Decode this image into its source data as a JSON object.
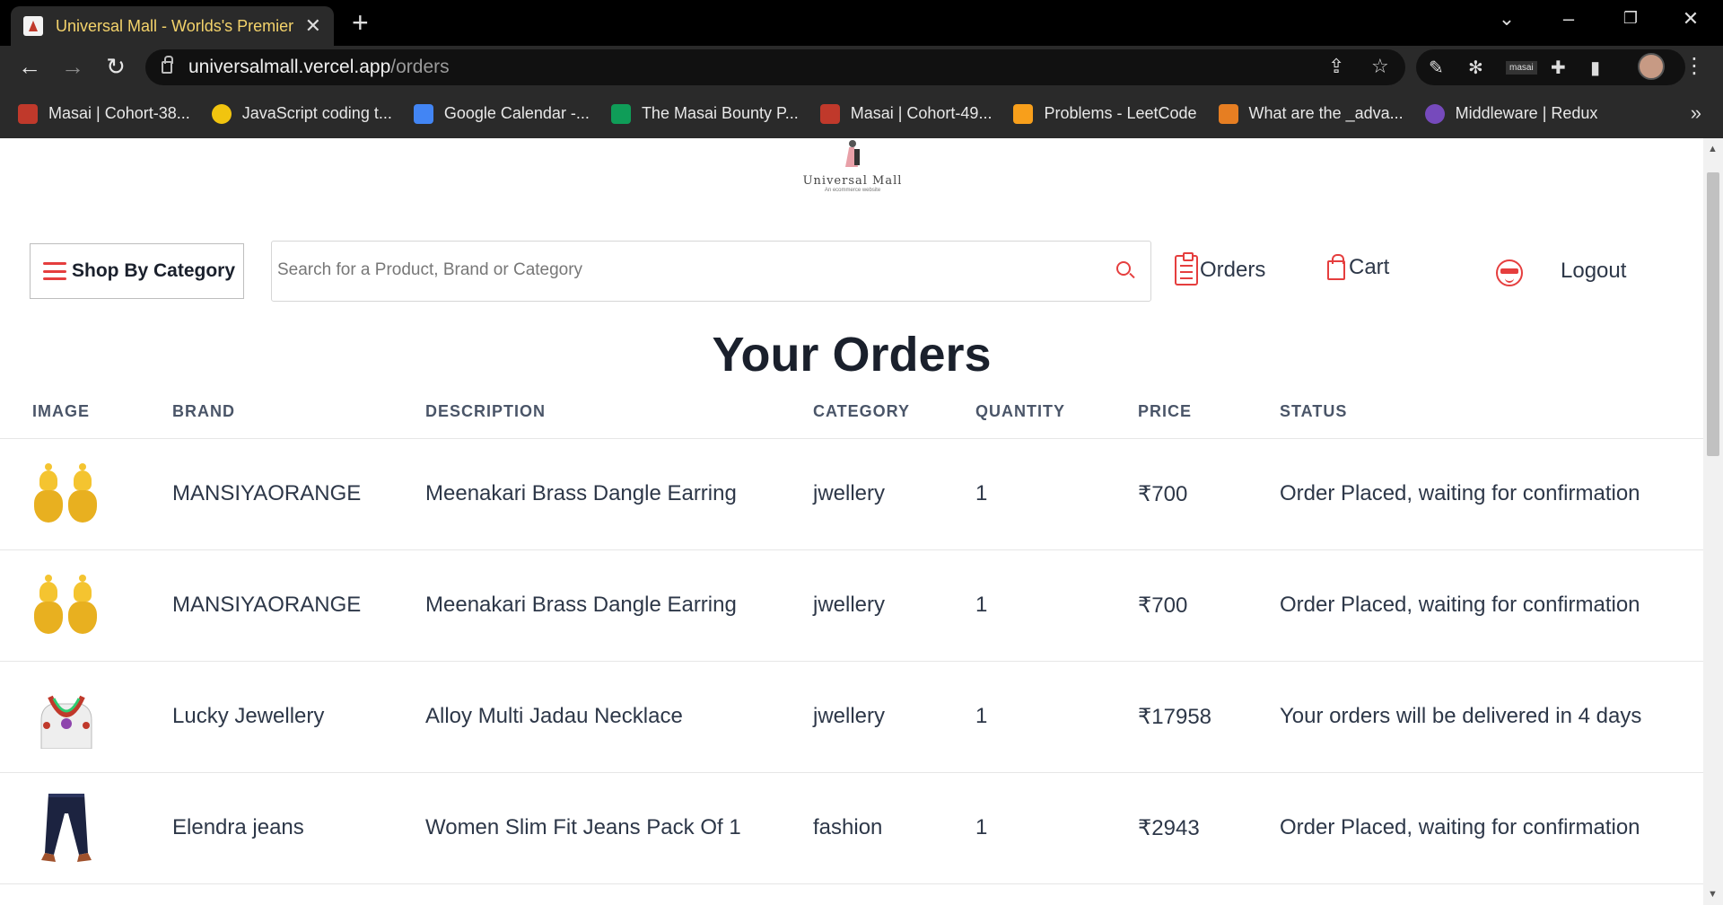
{
  "browser": {
    "tab_title": "Universal Mall - Worlds's Premier",
    "url_host": "universalmall.vercel.app",
    "url_path": "/orders",
    "bookmarks": [
      {
        "label": "Masai | Cohort-38...",
        "color": "#c0392b"
      },
      {
        "label": "JavaScript coding t...",
        "color": "#f1c40f"
      },
      {
        "label": "Google Calendar -...",
        "color": "#4285f4"
      },
      {
        "label": "The Masai Bounty P...",
        "color": "#0f9d58"
      },
      {
        "label": "Masai | Cohort-49...",
        "color": "#c0392b"
      },
      {
        "label": "Problems - LeetCode",
        "color": "#f89f1b"
      },
      {
        "label": "What are the _adva...",
        "color": "#e67e22"
      },
      {
        "label": "Middleware | Redux",
        "color": "#764abc"
      }
    ]
  },
  "header": {
    "logo_name": "Universal Mall",
    "logo_tagline": "An ecommerce website",
    "category_button": "Shop By Category",
    "search_placeholder": "Search for a Product, Brand or Category",
    "orders_label": "Orders",
    "cart_label": "Cart",
    "logout_label": "Logout",
    "accent_color": "#e53e3e"
  },
  "main": {
    "title": "Your Orders",
    "columns": [
      "IMAGE",
      "BRAND",
      "DESCRIPTION",
      "CATEGORY",
      "QUANTITY",
      "PRICE",
      "STATUS"
    ],
    "rows": [
      {
        "image": "earring-icon",
        "brand": "MANSIYAORANGE",
        "description": "Meenakari Brass Dangle Earring",
        "category": "jwellery",
        "quantity": "1",
        "price": "₹700",
        "status": "Order Placed, waiting for confirmation"
      },
      {
        "image": "earring-icon",
        "brand": "MANSIYAORANGE",
        "description": "Meenakari Brass Dangle Earring",
        "category": "jwellery",
        "quantity": "1",
        "price": "₹700",
        "status": "Order Placed, waiting for confirmation"
      },
      {
        "image": "necklace-icon",
        "brand": "Lucky Jewellery",
        "description": "Alloy Multi Jadau Necklace",
        "category": "jwellery",
        "quantity": "1",
        "price": "₹17958",
        "status": "Your orders will be delivered in 4 days"
      },
      {
        "image": "jeans-icon",
        "brand": "Elendra jeans",
        "description": "Women Slim Fit Jeans Pack Of 1",
        "category": "fashion",
        "quantity": "1",
        "price": "₹2943",
        "status": "Order Placed, waiting for confirmation"
      }
    ]
  }
}
